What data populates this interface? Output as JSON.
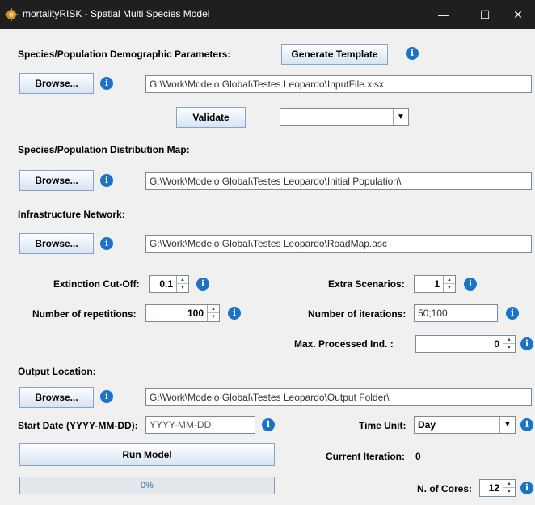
{
  "window": {
    "title": "mortalityRISK - Spatial Multi Species Model",
    "controls": {
      "minimize": "—",
      "maximize": "☐",
      "close": "✕"
    }
  },
  "demographic": {
    "heading": "Species/Population Demographic Parameters:",
    "generate_label": "Generate Template",
    "browse_label": "Browse...",
    "path": "G:\\Work\\Modelo Global\\Testes Leopardo\\InputFile.xlsx",
    "validate_label": "Validate",
    "validate_select": ""
  },
  "distribution": {
    "heading": "Species/Population Distribution Map:",
    "browse_label": "Browse...",
    "path": "G:\\Work\\Modelo Global\\Testes Leopardo\\Initial Population\\"
  },
  "infrastructure": {
    "heading": "Infrastructure Network:",
    "browse_label": "Browse...",
    "path": "G:\\Work\\Modelo Global\\Testes Leopardo\\RoadMap.asc"
  },
  "params": {
    "extinction_label": "Extinction Cut-Off:",
    "extinction_value": "0.1",
    "extra_label": "Extra Scenarios:",
    "extra_value": "1",
    "repetitions_label": "Number of repetitions:",
    "repetitions_value": "100",
    "iterations_label": "Number of iterations:",
    "iterations_value": "50;100",
    "maxproc_label": "Max. Processed Ind. :",
    "maxproc_value": "0"
  },
  "output": {
    "heading": "Output Location:",
    "browse_label": "Browse...",
    "path": "G:\\Work\\Modelo Global\\Testes Leopardo\\Output Folder\\"
  },
  "run": {
    "start_date_label": "Start Date (YYYY-MM-DD):",
    "start_date_placeholder": "YYYY-MM-DD",
    "time_unit_label": "Time Unit:",
    "time_unit_value": "Day",
    "run_label": "Run Model",
    "current_iteration_label": "Current Iteration:",
    "current_iteration_value": "0",
    "progress_text": "0%",
    "progress_fraction": 0,
    "cores_label": "N. of Cores:",
    "cores_value": "12"
  },
  "info_glyph": "i",
  "colors": {
    "titlebar": "#1f1f1f",
    "info_icon": "#1a73c8",
    "button_top": "#fdfeff",
    "button_bottom": "#d7e4f3"
  }
}
